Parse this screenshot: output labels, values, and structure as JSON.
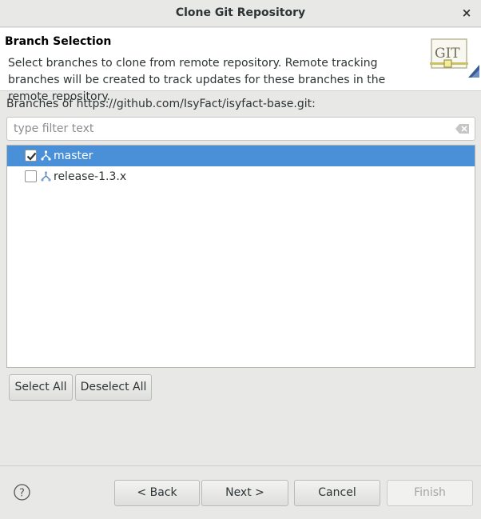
{
  "window": {
    "title": "Clone Git Repository",
    "close_glyph": "×"
  },
  "header": {
    "title": "Branch Selection",
    "description": "Select branches to clone from remote repository. Remote tracking branches will be created to track updates for these branches in the remote repository.",
    "logo_text": "GIT"
  },
  "repo_label": "Branches of https://github.com/IsyFact/isyfact-base.git:",
  "filter": {
    "placeholder": "type filter text",
    "value": ""
  },
  "branches": [
    {
      "label": "master",
      "checked": true,
      "selected": true
    },
    {
      "label": "release-1.3.x",
      "checked": false,
      "selected": false
    }
  ],
  "selection_buttons": {
    "select_all": "Select All",
    "deselect_all": "Deselect All"
  },
  "footer": {
    "back": "< Back",
    "next": "Next >",
    "cancel": "Cancel",
    "finish": "Finish",
    "help_glyph": "?"
  },
  "colors": {
    "selection": "#4a90d9",
    "window_bg": "#e8e8e7"
  }
}
